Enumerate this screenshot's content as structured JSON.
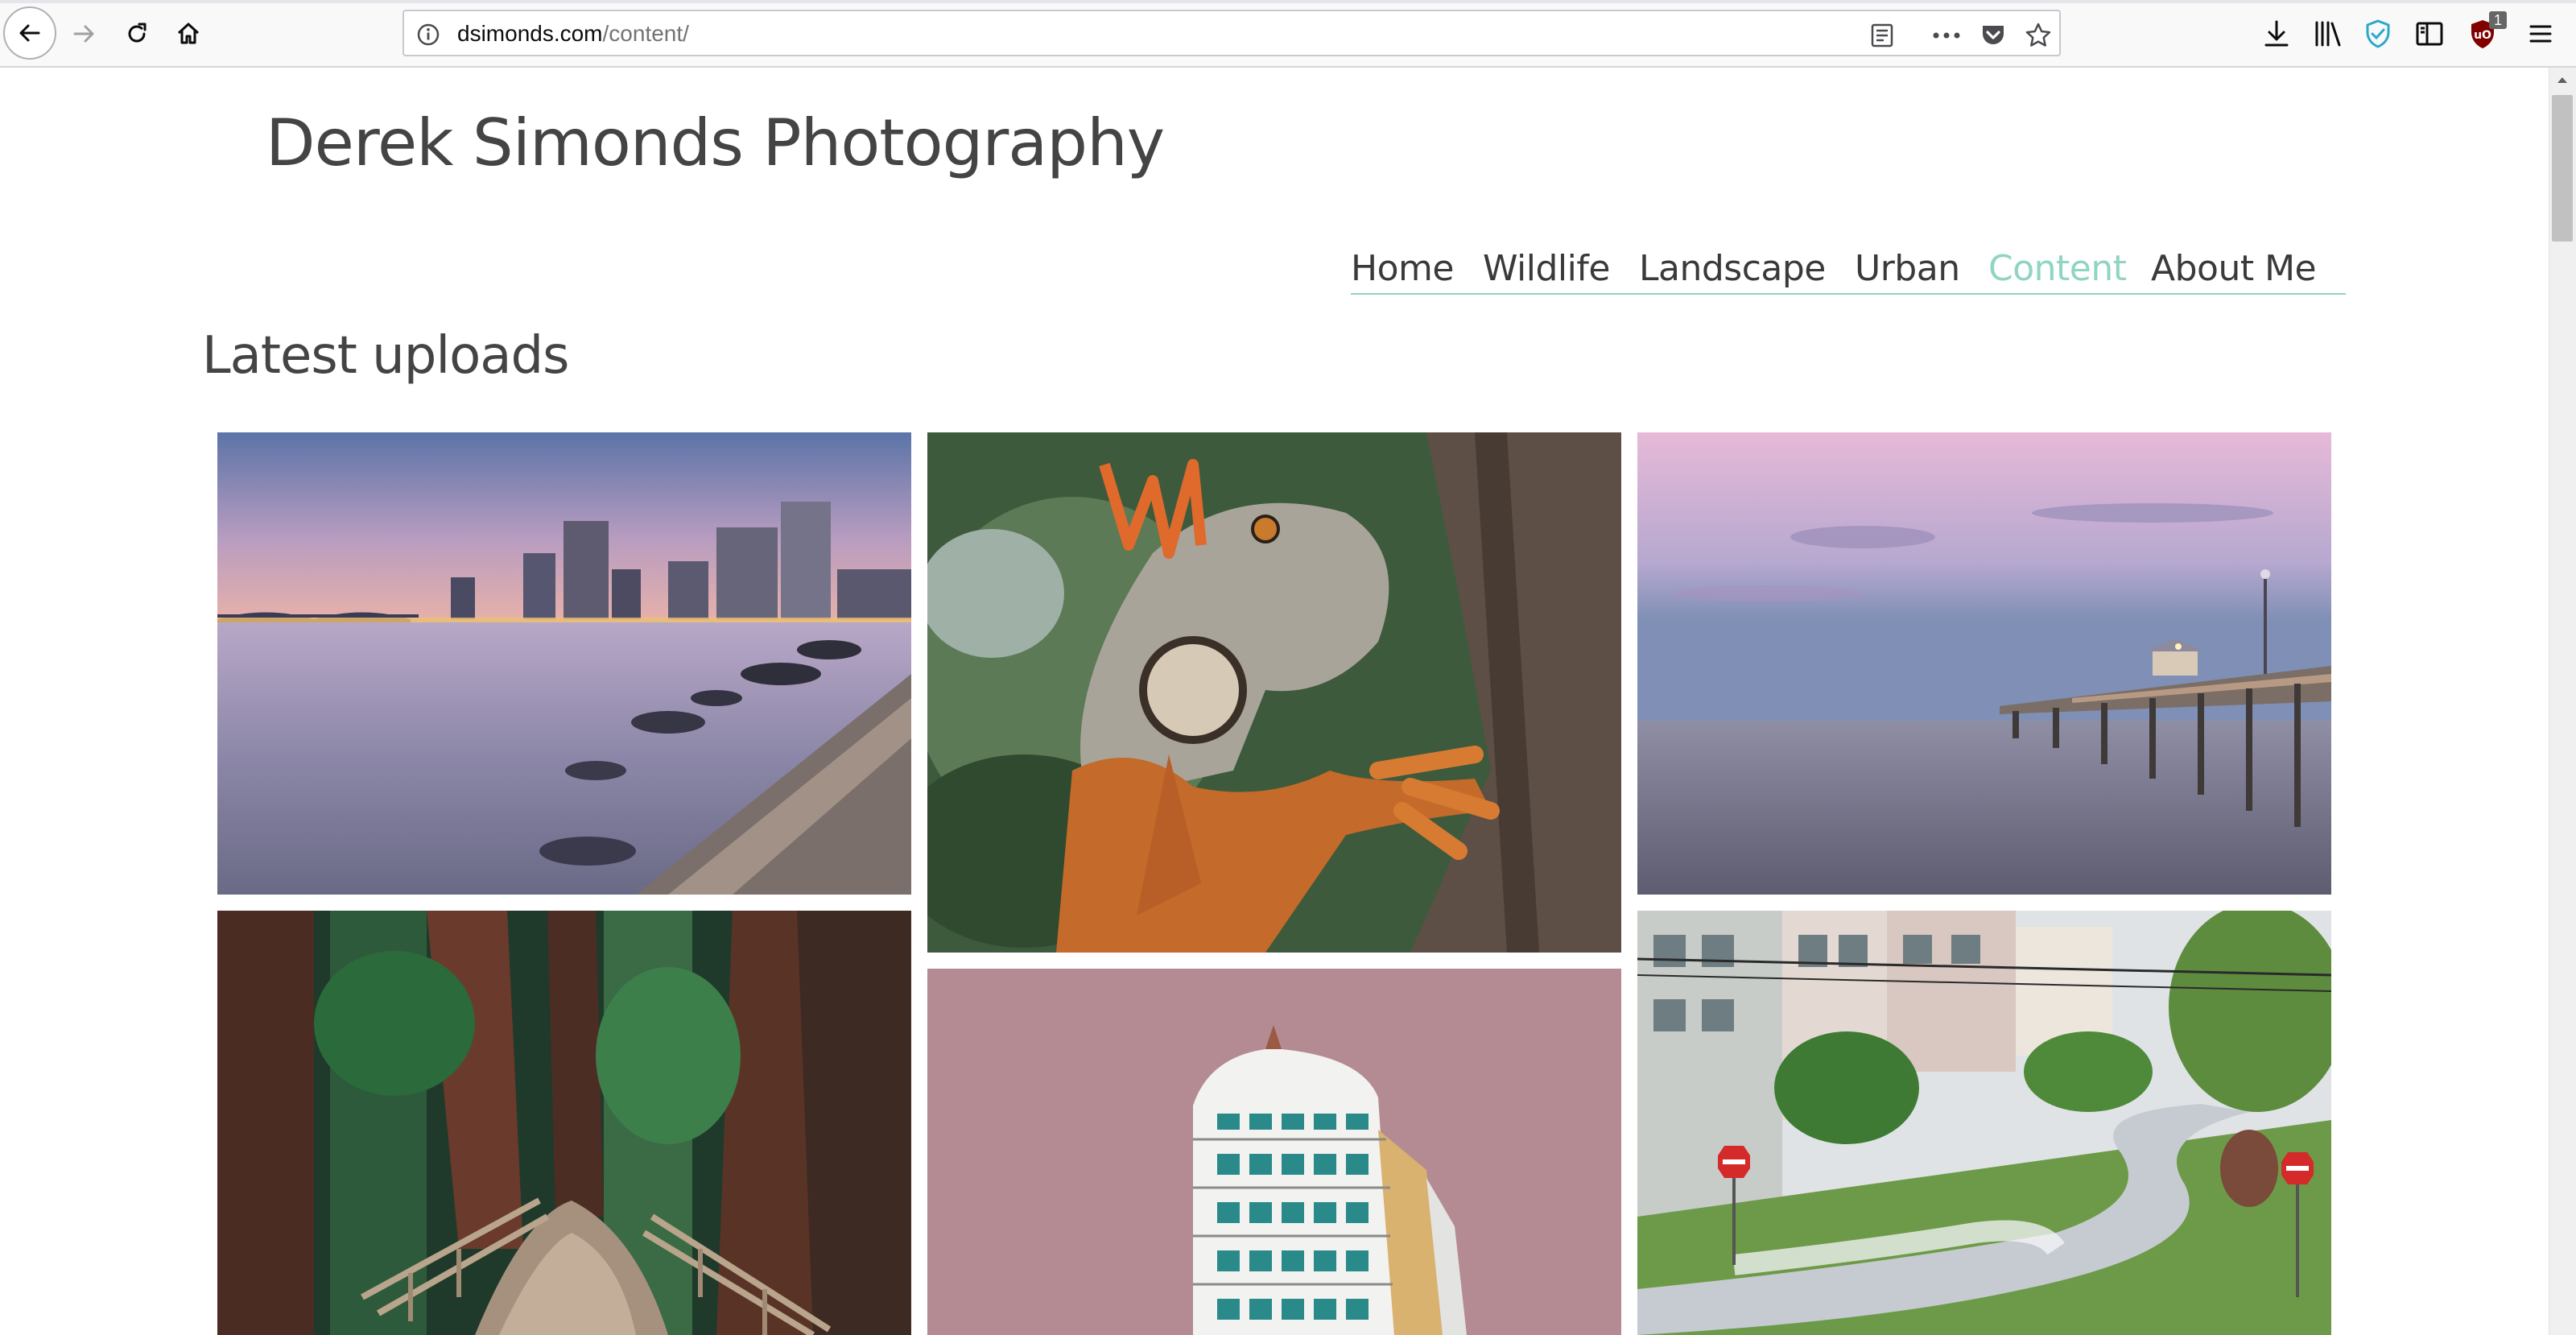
{
  "browser": {
    "url_domain": "dsimonds.com",
    "url_path": "/content/",
    "extension_badge_count": "1",
    "icons": [
      "back-icon",
      "forward-icon",
      "reload-icon",
      "home-icon",
      "site-info-icon",
      "reader-view-icon",
      "page-actions-icon",
      "pocket-icon",
      "bookmark-star-icon",
      "downloads-icon",
      "library-icon",
      "shield-extension-icon",
      "sidebar-icon",
      "ublock-icon",
      "menu-icon"
    ]
  },
  "site": {
    "title": "Derek Simonds Photography"
  },
  "nav": {
    "items": [
      {
        "label": "Home"
      },
      {
        "label": "Wildlife"
      },
      {
        "label": "Landscape"
      },
      {
        "label": "Urban"
      },
      {
        "label": "Content"
      },
      {
        "label": "About Me"
      }
    ],
    "active_index": 4,
    "active_color": "#90d4c3",
    "underline_color": "#8fd3c0"
  },
  "main": {
    "heading": "Latest uploads"
  },
  "gallery": {
    "photos": [
      {
        "subject": "city skyline at dusk over river with bridge"
      },
      {
        "subject": "green iguana on tree trunk"
      },
      {
        "subject": "fishing pier over calm sea at pink dusk"
      },
      {
        "subject": "redwood forest trail with wooden fence"
      },
      {
        "subject": "white apartment tower against mauve background"
      },
      {
        "subject": "steep winding street with do not enter signs"
      }
    ]
  }
}
